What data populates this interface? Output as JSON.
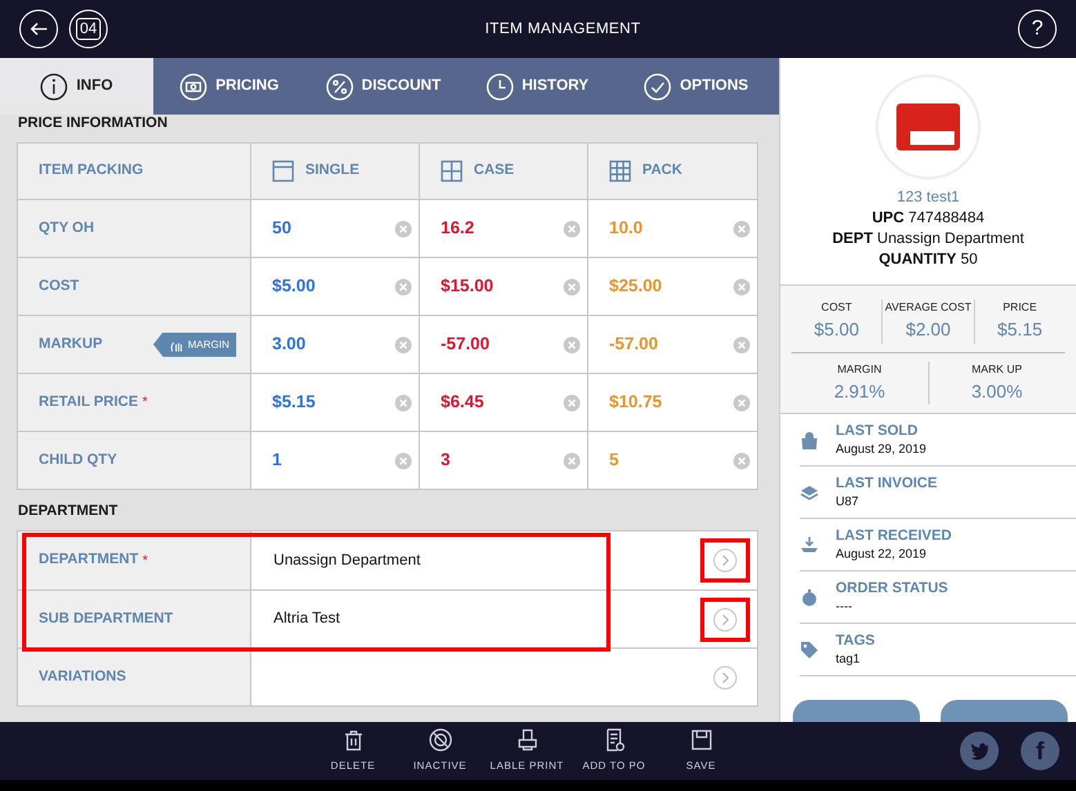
{
  "header": {
    "badge": "04",
    "title": "ITEM MANAGEMENT",
    "help": "?"
  },
  "tabs": [
    {
      "label": "INFO",
      "kind": "info",
      "selected": true
    },
    {
      "label": "PRICING",
      "kind": "cash",
      "selected": false
    },
    {
      "label": "DISCOUNT",
      "kind": "percent",
      "selected": false
    },
    {
      "label": "HISTORY",
      "kind": "clock",
      "selected": false
    },
    {
      "label": "OPTIONS",
      "kind": "check",
      "selected": false
    }
  ],
  "price_information": {
    "heading": "PRICE INFORMATION",
    "corner": "ITEM PACKING",
    "columns": [
      {
        "label": "SINGLE",
        "kind": "single",
        "color": "#2f73e0"
      },
      {
        "label": "CASE",
        "kind": "case",
        "color": "#e3142f"
      },
      {
        "label": "PACK",
        "kind": "pack",
        "color": "#e8962c"
      }
    ],
    "rows": [
      {
        "label": "QTY OH",
        "values": [
          "50",
          "16.2",
          "10.0"
        ]
      },
      {
        "label": "COST",
        "values": [
          "$5.00",
          "$15.00",
          "$25.00"
        ]
      },
      {
        "label": "MARKUP",
        "tag": "MARGIN",
        "values": [
          "3.00",
          "-57.00",
          "-57.00"
        ]
      },
      {
        "label": "RETAIL PRICE",
        "required_mark": "*",
        "values": [
          "$5.15",
          "$6.45",
          "$10.75"
        ]
      },
      {
        "label": "CHILD QTY",
        "values": [
          "1",
          "3",
          "5"
        ]
      }
    ]
  },
  "department": {
    "heading": "DEPARTMENT",
    "rows": [
      {
        "label": "DEPARTMENT",
        "required_mark": "*",
        "value": "Unassign Department",
        "highlighted": true,
        "chevron_highlighted": true
      },
      {
        "label": "SUB DEPARTMENT",
        "value": "Altria Test",
        "highlighted": true,
        "chevron_highlighted": true
      },
      {
        "label": "VARIATIONS",
        "highlighted": false,
        "chevron_highlighted": false
      }
    ]
  },
  "product": {
    "name": "123 test1",
    "details": [
      "**UPC** 747488484",
      "**DEPT** Unassign Department",
      "**QUANTITY** 50"
    ],
    "stats": [
      [
        {
          "label": "COST",
          "value": "$5.00"
        },
        {
          "label": "AVERAGE COST",
          "value": "$2.00"
        },
        {
          "label": "PRICE",
          "value": "$5.15"
        }
      ],
      [
        {
          "label": "MARGIN",
          "value": "2.91%"
        },
        {
          "label": "MARK UP",
          "value": "3.00%"
        }
      ]
    ],
    "history": [
      {
        "kind": "bag",
        "label": "LAST SOLD",
        "value": "August 29, 2019"
      },
      {
        "kind": "layers",
        "label": "LAST INVOICE",
        "value": "U87"
      },
      {
        "kind": "tray",
        "label": "LAST RECEIVED",
        "value": "August 22, 2019"
      },
      {
        "kind": "timer",
        "label": "ORDER STATUS",
        "value": "----"
      },
      {
        "kind": "tag",
        "label": "TAGS",
        "value": "tag1"
      }
    ]
  },
  "footer": {
    "actions": [
      {
        "label": "DELETE",
        "kind": "trash"
      },
      {
        "label": "INACTIVE",
        "kind": "inactive"
      },
      {
        "label": "LABLE PRINT",
        "kind": "printer"
      },
      {
        "label": "ADD TO PO",
        "kind": "list"
      },
      {
        "label": "SAVE",
        "kind": "disk"
      }
    ],
    "social": [
      {
        "kind": "bird"
      },
      {
        "kind": "letter",
        "glyph": "f"
      }
    ]
  }
}
